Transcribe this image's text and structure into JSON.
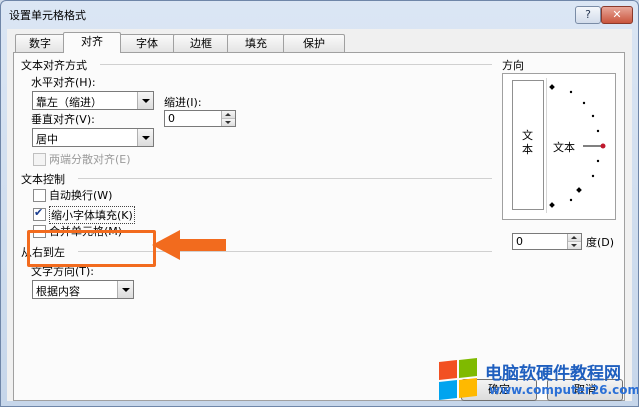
{
  "window": {
    "title": "设置单元格格式",
    "help": "?",
    "close": "✕"
  },
  "tabs": [
    "数字",
    "对齐",
    "字体",
    "边框",
    "填充",
    "保护"
  ],
  "text_alignment": {
    "group_title": "文本对齐方式",
    "horizontal_label": "水平对齐(H):",
    "horizontal_value": "靠左（缩进）",
    "indent_label": "缩进(I):",
    "indent_value": "0",
    "vertical_label": "垂直对齐(V):",
    "vertical_value": "居中",
    "justify_distributed": "两端分散对齐(E)"
  },
  "text_control": {
    "group_title": "文本控制",
    "wrap_text": "自动换行(W)",
    "shrink_to_fit": "缩小字体填充(K)",
    "merge_cells": "合并单元格(M)"
  },
  "rtl": {
    "group_title": "从右到左",
    "direction_label": "文字方向(T):",
    "direction_value": "根据内容"
  },
  "orientation": {
    "title": "方向",
    "vertical_text": "文本",
    "dial_text": "文本",
    "degree_value": "0",
    "degree_label": "度(D)"
  },
  "buttons": {
    "ok": "确定",
    "cancel": "取消"
  },
  "watermark": {
    "title": "电脑软硬件教程网",
    "url": "www.computer26.com"
  },
  "colors": {
    "highlight": "#f26b1e",
    "indicator": "#c0182c"
  }
}
